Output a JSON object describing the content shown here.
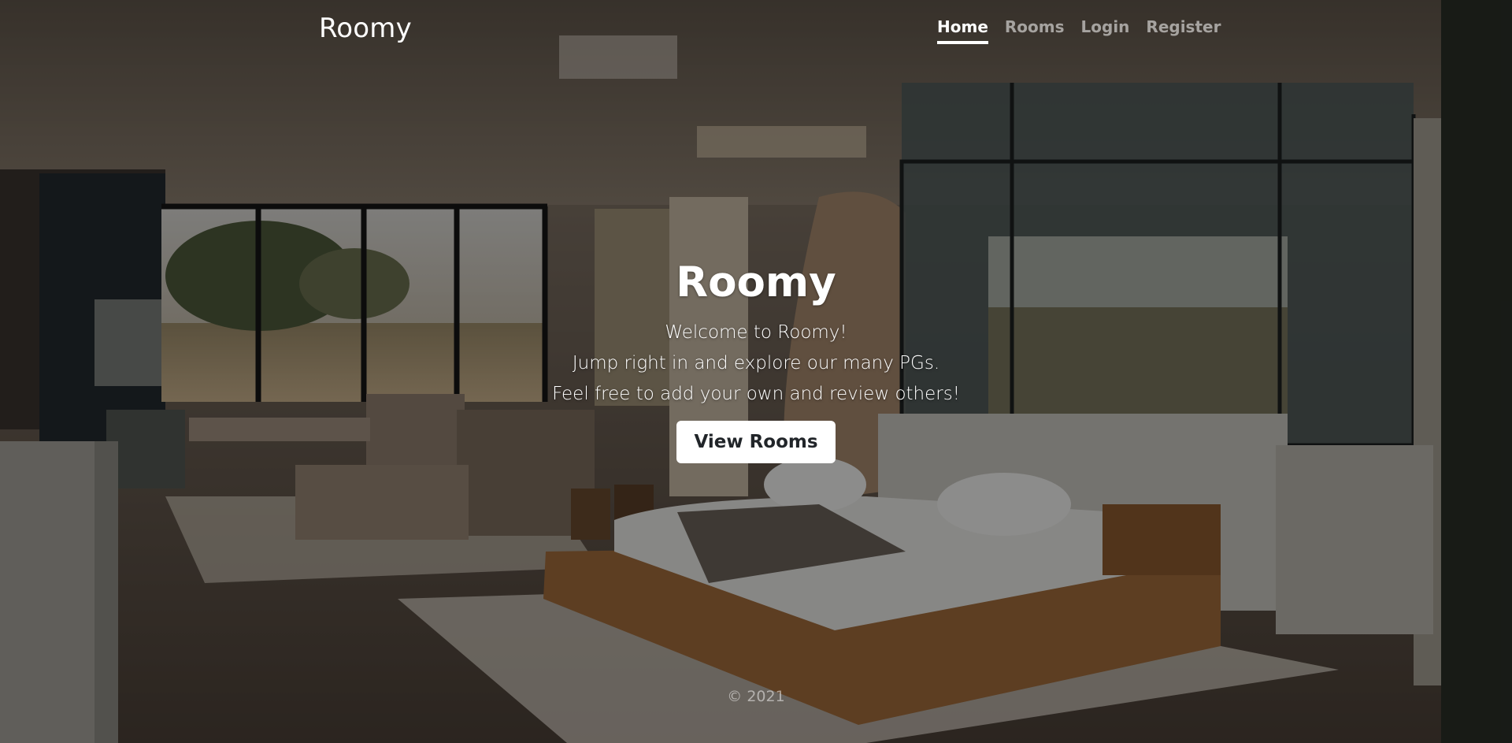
{
  "nav": {
    "brand": "Roomy",
    "links": [
      {
        "label": "Home",
        "active": true
      },
      {
        "label": "Rooms",
        "active": false
      },
      {
        "label": "Login",
        "active": false
      },
      {
        "label": "Register",
        "active": false
      }
    ]
  },
  "hero": {
    "title": "Roomy",
    "lines": [
      "Welcome to Roomy!",
      "Jump right in and explore our many PGs.",
      "Feel free to add your own and review others!"
    ],
    "button": "View Rooms"
  },
  "footer": {
    "text": "© 2021"
  },
  "background": {
    "description_icon": "bedroom-photo",
    "overlay_color": "#000000"
  }
}
